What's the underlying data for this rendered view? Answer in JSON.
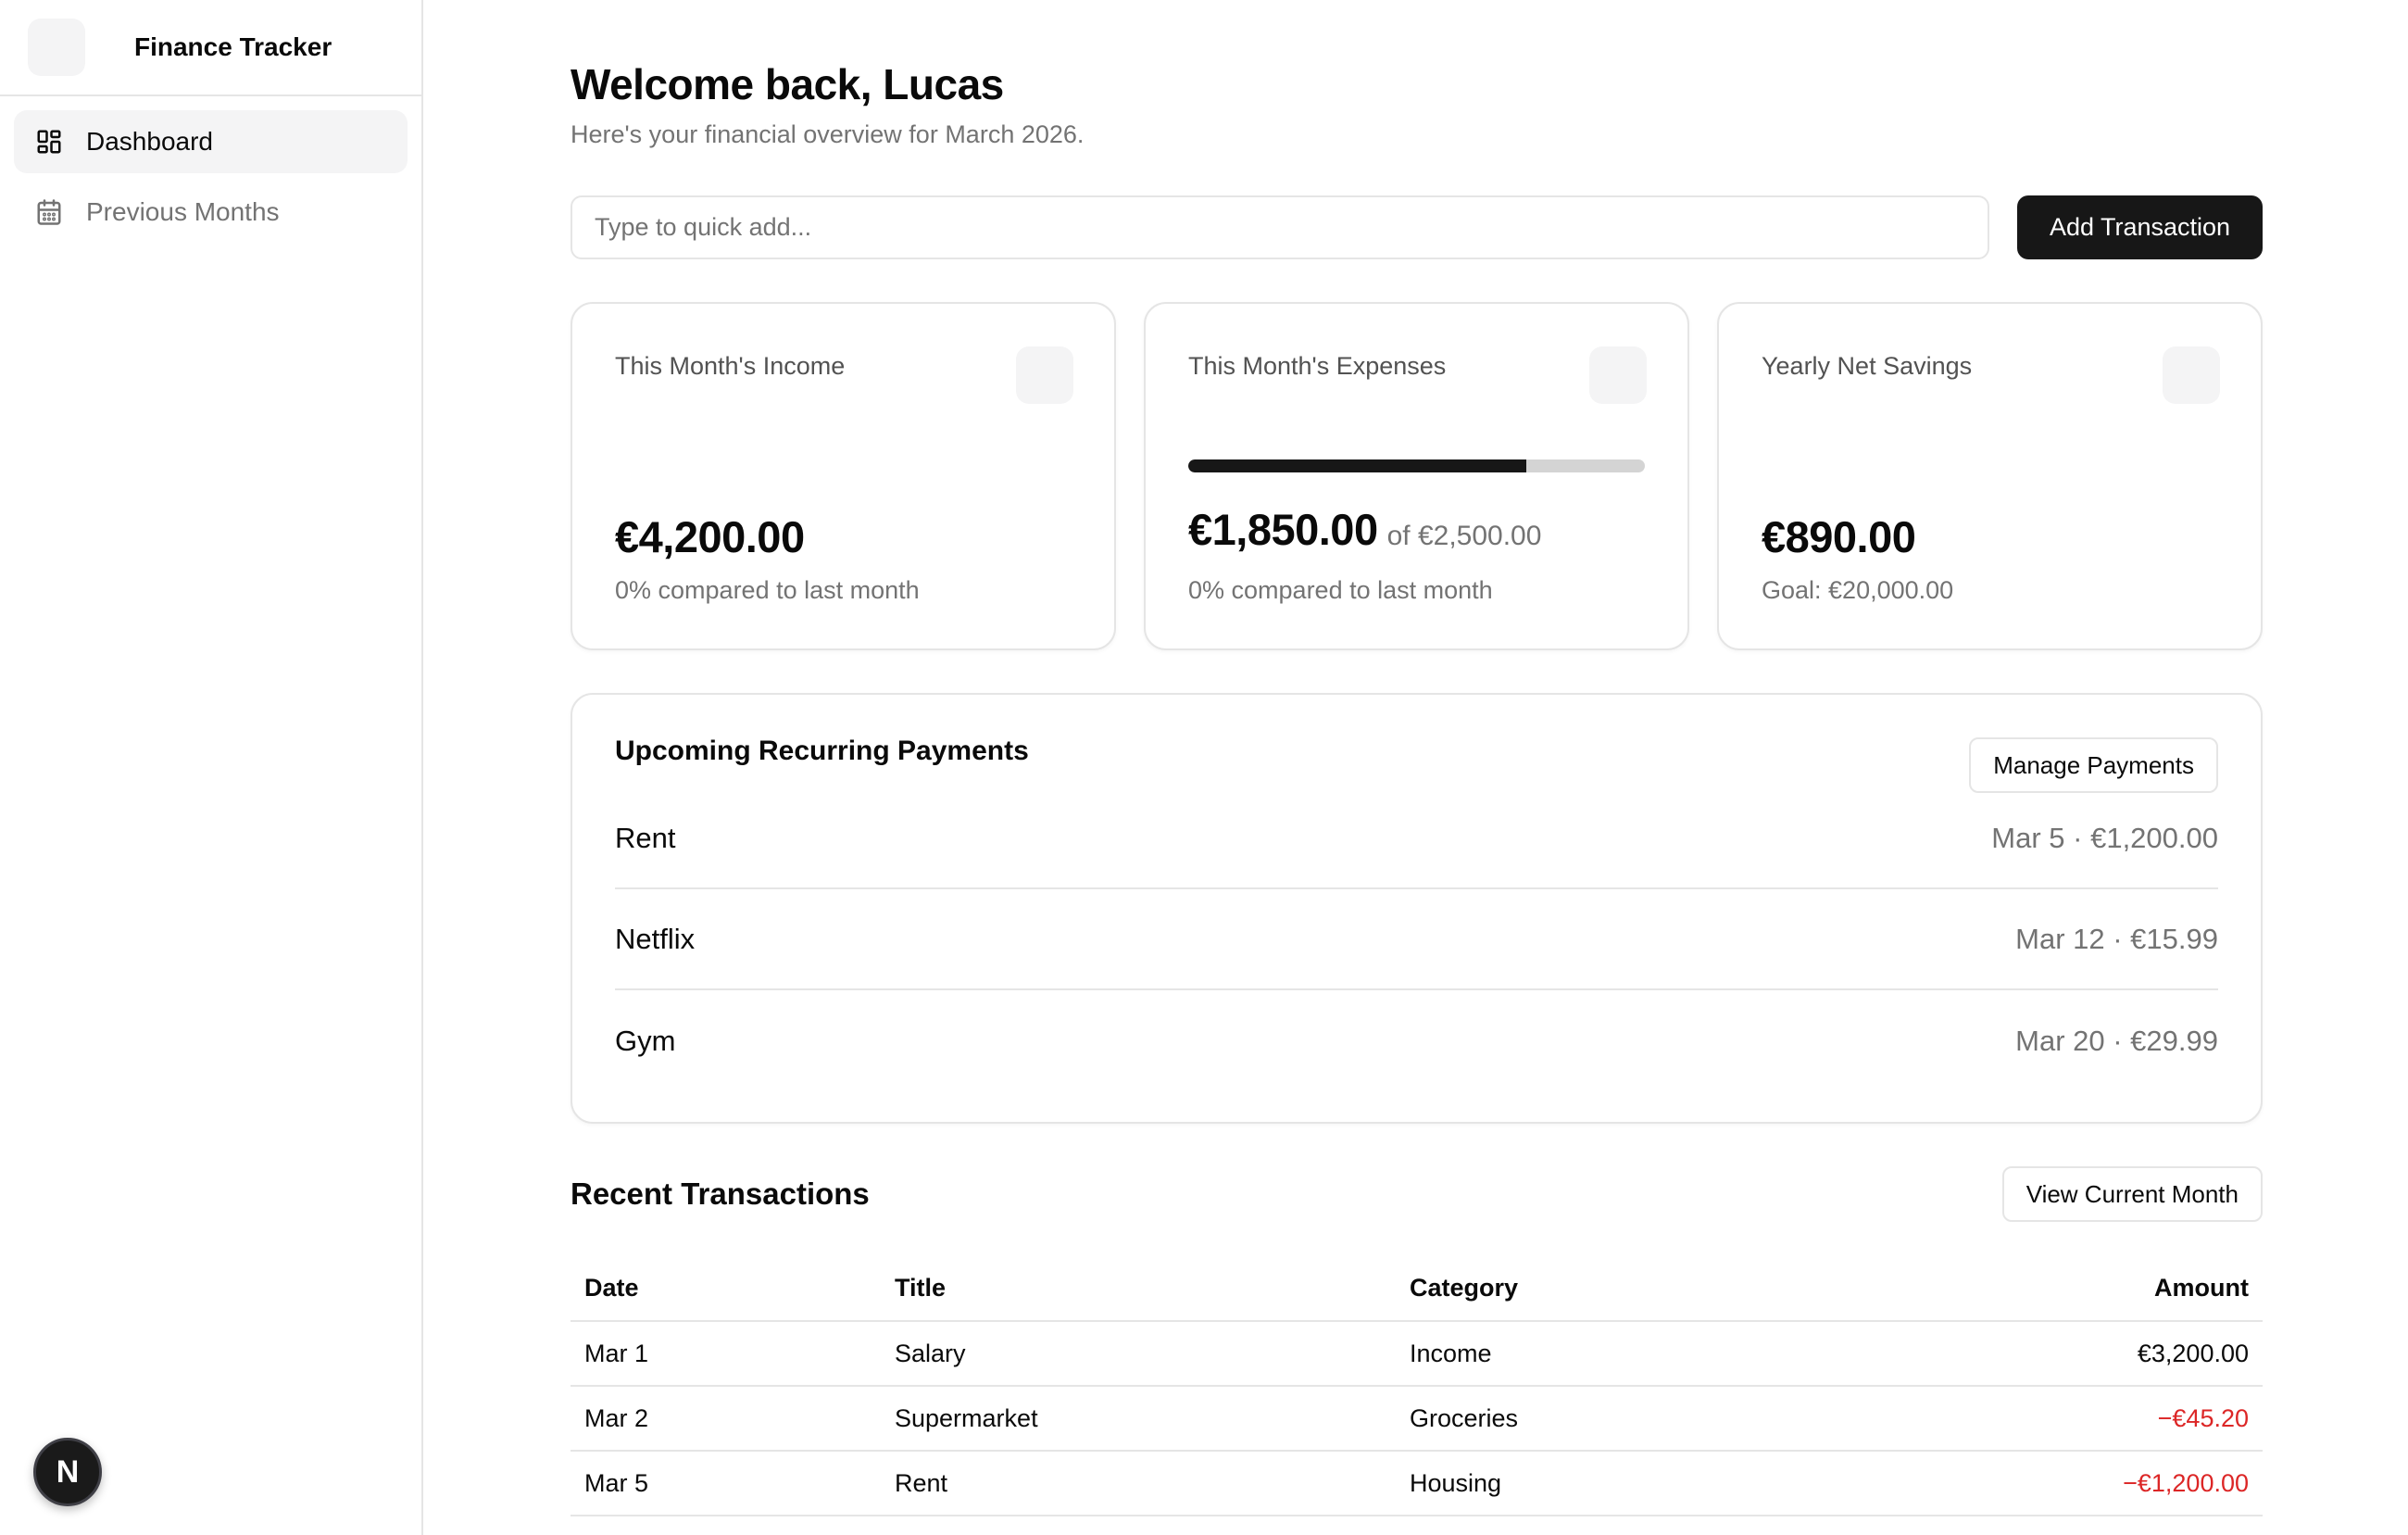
{
  "app": {
    "name": "Finance Tracker"
  },
  "sidebar": {
    "items": [
      {
        "label": "Dashboard",
        "icon": "dashboard-grid-icon",
        "active": true
      },
      {
        "label": "Previous Months",
        "icon": "calendar-icon",
        "active": false
      }
    ],
    "badge": "N"
  },
  "header": {
    "title": "Welcome back, Lucas",
    "subtitle": "Here's your financial overview for March 2026."
  },
  "quick_add": {
    "placeholder": "Type to quick add...",
    "value": "",
    "button_label": "Add Transaction"
  },
  "cards": {
    "income": {
      "title": "This Month's Income",
      "value": "€4,200.00",
      "footer": "0% compared to last month"
    },
    "expenses": {
      "title": "This Month's Expenses",
      "value": "€1,850.00",
      "of": "of €2,500.00",
      "progress": 0.74,
      "footer": "0% compared to last month"
    },
    "savings": {
      "title": "Yearly Net Savings",
      "value": "€890.00",
      "footer": "Goal: €20,000.00"
    }
  },
  "recurring": {
    "title": "Upcoming Recurring Payments",
    "button_label": "Manage Payments",
    "items": [
      {
        "name": "Rent",
        "meta": "Mar 5 · €1,200.00"
      },
      {
        "name": "Netflix",
        "meta": "Mar 12 · €15.99"
      },
      {
        "name": "Gym",
        "meta": "Mar 20 · €29.99"
      }
    ]
  },
  "transactions": {
    "title": "Recent Transactions",
    "button_label": "View Current Month",
    "columns": [
      "Date",
      "Title",
      "Category",
      "Amount"
    ],
    "rows": [
      {
        "date": "Mar 1",
        "title": "Salary",
        "category": "Income",
        "amount": "€3,200.00",
        "negative": false
      },
      {
        "date": "Mar 2",
        "title": "Supermarket",
        "category": "Groceries",
        "amount": "−€45.20",
        "negative": true
      },
      {
        "date": "Mar 5",
        "title": "Rent",
        "category": "Housing",
        "amount": "−€1,200.00",
        "negative": true
      }
    ]
  },
  "colors": {
    "accent": "#171717",
    "negative": "#dc2626",
    "muted_text": "#737373",
    "border": "#e5e5e5"
  }
}
